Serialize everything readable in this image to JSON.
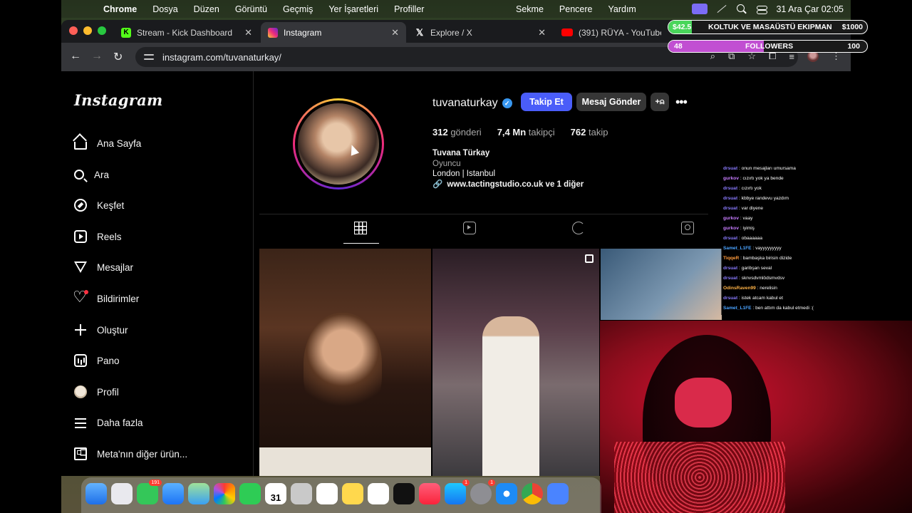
{
  "menubar": {
    "app_name": "Chrome",
    "menus": [
      "Dosya",
      "Düzen",
      "Görüntü",
      "Geçmiş",
      "Yer İşaretleri",
      "Profiller"
    ],
    "menus_right": [
      "Sekme",
      "Pencere",
      "Yardım"
    ],
    "clock": "31 Ara Çar  02:05"
  },
  "tabs": [
    {
      "title": "Stream - Kick Dashboard",
      "icon": "kick-icon"
    },
    {
      "title": "Instagram",
      "icon": "instagram-icon",
      "active": true
    },
    {
      "title": "Explore / X",
      "icon": "x-icon"
    },
    {
      "title": "(391) RÜYA - YouTube",
      "icon": "youtube-icon"
    }
  ],
  "omnibox": {
    "url": "instagram.com/tuvanaturkay/"
  },
  "instagram": {
    "logo": "Instagram",
    "nav": [
      "Ana Sayfa",
      "Ara",
      "Keşfet",
      "Reels",
      "Mesajlar",
      "Bildirimler",
      "Oluştur",
      "Pano",
      "Profil",
      "Daha fazla",
      "Meta'nın diğer ürün..."
    ],
    "profile": {
      "username": "tuvanaturkay",
      "verified": true,
      "follow_label": "Takip Et",
      "message_label": "Mesaj Gönder",
      "posts_count": "312",
      "posts_label": "gönderi",
      "followers_count": "7,4 Mn",
      "followers_label": "takipçi",
      "following_count": "762",
      "following_label": "takip",
      "display_name": "Tuvana Türkay",
      "category": "Oyuncu",
      "location": "London | Istanbul",
      "link": "www.tactingstudio.co.uk ve 1 diğer"
    }
  },
  "overlays": {
    "goal_money": {
      "current": "$42.5",
      "title": "KOLTUK VE MASAÜSTÜ EKIPMAN",
      "target": "$1000",
      "progress": 0.0425,
      "color": "#49d65b"
    },
    "goal_followers": {
      "current": "48",
      "title": "FOLLOWERS",
      "target": "100",
      "progress": 0.48,
      "color": "#c14fd2"
    },
    "chat": [
      {
        "user": "drsuat",
        "color": "#8a7bff",
        "msg": "onun mesajları umursama"
      },
      {
        "user": "gurkov",
        "color": "#c77dff",
        "msg": "cızırtı yok ya bende"
      },
      {
        "user": "drsuat",
        "color": "#8a7bff",
        "msg": "cızırtı yok"
      },
      {
        "user": "drsuat",
        "color": "#8a7bff",
        "msg": "kbbye randevu yazdım"
      },
      {
        "user": "drsuat",
        "color": "#8a7bff",
        "msg": "var diyene"
      },
      {
        "user": "gurkov",
        "color": "#c77dff",
        "msg": "vaay"
      },
      {
        "user": "gurkov",
        "color": "#c77dff",
        "msg": "iyimiş"
      },
      {
        "user": "drsuat",
        "color": "#8a7bff",
        "msg": "obaaaaaa"
      },
      {
        "user": "Samet_L1FE",
        "color": "#4aa3ff",
        "msg": "vayyyyyyyyy"
      },
      {
        "user": "TiqqeR",
        "color": "#ff9b3d",
        "msg": "bambaşka birisin dizide"
      },
      {
        "user": "drsuat",
        "color": "#8a7bff",
        "msg": "garibşan seval"
      },
      {
        "user": "drsuat",
        "color": "#8a7bff",
        "msg": "sknvsdvmlödsmvdsv"
      },
      {
        "user": "OdinsRaven99",
        "color": "#ffb347",
        "msg": "nerelisin"
      },
      {
        "user": "drsuat",
        "color": "#8a7bff",
        "msg": "istek atcam kabul et"
      },
      {
        "user": "Samet_L1FE",
        "color": "#4aa3ff",
        "msg": "ben attım da kabul etmedi :("
      }
    ]
  },
  "dock": {
    "calendar_month": "ARA",
    "calendar_day": "31",
    "messages_badge": "191",
    "appstore_badge": "1",
    "settings_badge": "1"
  }
}
